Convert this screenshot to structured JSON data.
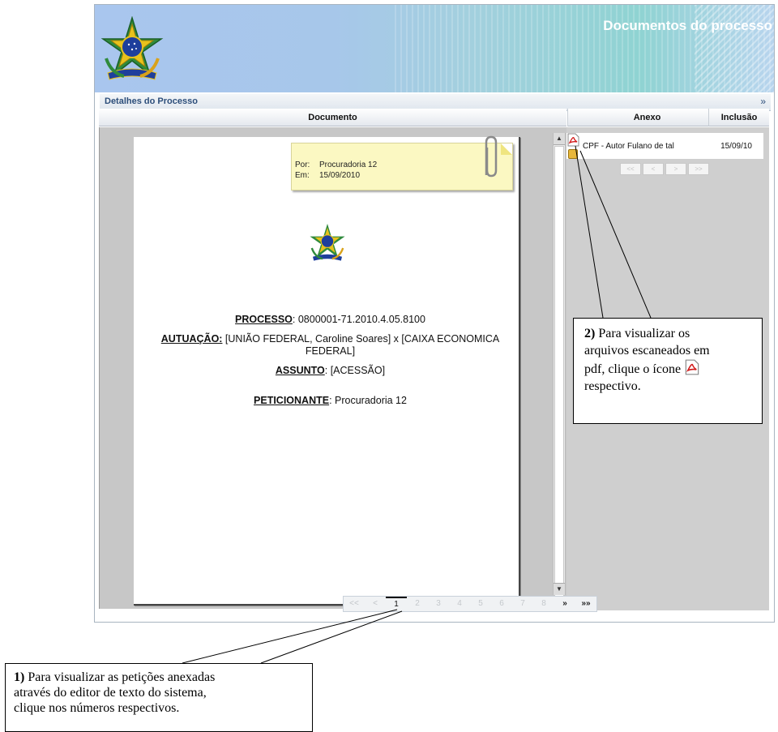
{
  "app": {
    "title": "Documentos do processo",
    "section_title": "Detalhes do Processo",
    "section_toggle": "»"
  },
  "columns": {
    "documento": "Documento",
    "anexo": "Anexo",
    "inclusao": "Inclusão"
  },
  "postit": {
    "por_label": "Por:",
    "por_value": "Procuradoria 12",
    "em_label": "Em:",
    "em_value": "15/09/2010"
  },
  "document": {
    "processo_label": "PROCESSO",
    "processo_value": ": 0800001-71.2010.4.05.8100",
    "autuacao_label": "AUTUAÇÃO:",
    "autuacao_value": " [UNIÃO FEDERAL, Caroline Soares] x [CAIXA ECONOMICA FEDERAL]",
    "assunto_label": "ASSUNTO",
    "assunto_value": ": [ACESSÃO]",
    "peticionante_label": "PETICIONANTE",
    "peticionante_value": ": Procuradoria 12"
  },
  "pager": {
    "first": "<<",
    "prev": "<",
    "pages": [
      "1",
      "2",
      "3",
      "4",
      "5",
      "6",
      "7",
      "8"
    ],
    "active_page": "1",
    "next": "»",
    "last": "»»"
  },
  "anexos": [
    {
      "name": "CPF - Autor Fulano de tal",
      "date": "15/09/10",
      "icon": "pdf-icon"
    }
  ],
  "anexo_pager": {
    "first": "<<",
    "prev": "<",
    "next": ">",
    "last": ">>"
  },
  "callout_2": {
    "number": "2)",
    "line1": " Para visualizar os",
    "line2": "arquivos escaneados em",
    "line3": "pdf, clique o ícone",
    "line4": "respectivo."
  },
  "callout_1": {
    "number": "1)",
    "line1": " Para visualizar as petições anexadas",
    "line2": "através do editor de texto do sistema,",
    "line3": "clique nos números respectivos."
  },
  "colors": {
    "header_blue": "#a9c6ee",
    "header_teal": "#8fd3d2",
    "title_text": "#ffffff",
    "postit": "#fbf8c2"
  }
}
